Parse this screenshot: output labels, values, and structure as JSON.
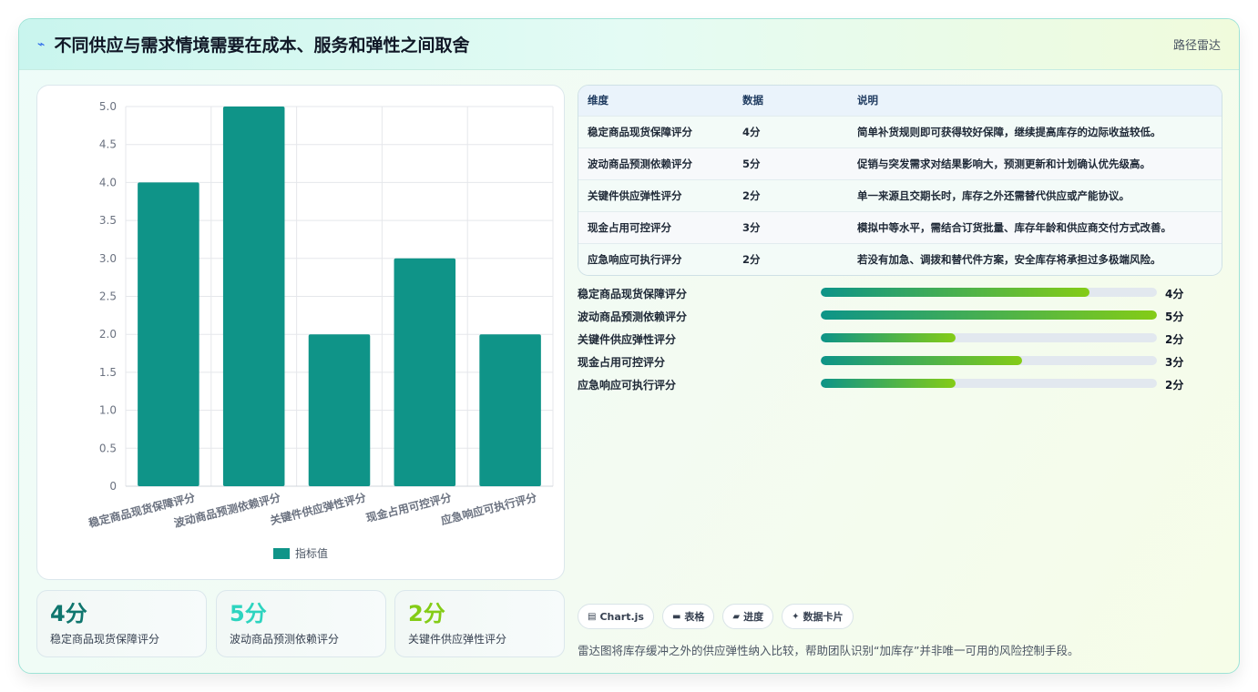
{
  "header": {
    "icon": "lightning-icon",
    "title": "不同供应与需求情境需要在成本、服务和弹性之间取舍",
    "right_label": "路径雷达"
  },
  "colors": {
    "bar": "#0f9488",
    "accent_teal": "#0f766e",
    "accent_cyan": "#2dd4bf",
    "accent_lime": "#84cc16"
  },
  "chart_data": {
    "type": "bar",
    "categories": [
      "稳定商品现货保障评分",
      "波动商品预测依赖评分",
      "关键件供应弹性评分",
      "现金占用可控评分",
      "应急响应可执行评分"
    ],
    "series": [
      {
        "name": "指标值",
        "values": [
          4,
          5,
          2,
          3,
          2
        ]
      }
    ],
    "ylim": [
      0,
      5
    ],
    "yticks": [
      "0",
      "0.5",
      "1.0",
      "1.5",
      "2.0",
      "2.5",
      "3.0",
      "3.5",
      "4.0",
      "4.5",
      "5.0"
    ],
    "grid": true,
    "legend": "bottom"
  },
  "stats": [
    {
      "value": "4分",
      "label": "稳定商品现货保障评分",
      "color": "#0f766e"
    },
    {
      "value": "5分",
      "label": "波动商品预测依赖评分",
      "color": "#2dd4bf"
    },
    {
      "value": "2分",
      "label": "关键件供应弹性评分",
      "color": "#84cc16"
    }
  ],
  "table": {
    "headers": [
      "维度",
      "数据",
      "说明"
    ],
    "rows": [
      [
        "稳定商品现货保障评分",
        "4分",
        "简单补货规则即可获得较好保障，继续提高库存的边际收益较低。"
      ],
      [
        "波动商品预测依赖评分",
        "5分",
        "促销与突发需求对结果影响大，预测更新和计划确认优先级高。"
      ],
      [
        "关键件供应弹性评分",
        "2分",
        "单一来源且交期长时，库存之外还需替代供应或产能协议。"
      ],
      [
        "现金占用可控评分",
        "3分",
        "模拟中等水平，需结合订货批量、库存年龄和供应商交付方式改善。"
      ],
      [
        "应急响应可执行评分",
        "2分",
        "若没有加急、调拨和替代件方案，安全库存将承担过多极端风险。"
      ]
    ]
  },
  "progress": {
    "max": 5,
    "items": [
      {
        "label": "稳定商品现货保障评分",
        "value": 4,
        "value_label": "4分"
      },
      {
        "label": "波动商品预测依赖评分",
        "value": 5,
        "value_label": "5分"
      },
      {
        "label": "关键件供应弹性评分",
        "value": 2,
        "value_label": "2分"
      },
      {
        "label": "现金占用可控评分",
        "value": 3,
        "value_label": "3分"
      },
      {
        "label": "应急响应可执行评分",
        "value": 2,
        "value_label": "2分"
      }
    ]
  },
  "chips": [
    {
      "icon": "chart-icon",
      "glyph": "▤",
      "label": "Chart.js"
    },
    {
      "icon": "table-icon",
      "glyph": "▬",
      "label": "表格"
    },
    {
      "icon": "progress-icon",
      "glyph": "▰",
      "label": "进度"
    },
    {
      "icon": "sparkle-icon",
      "glyph": "✦",
      "label": "数据卡片"
    }
  ],
  "footer_note": "雷达图将库存缓冲之外的供应弹性纳入比较，帮助团队识别“加库存”并非唯一可用的风险控制手段。"
}
